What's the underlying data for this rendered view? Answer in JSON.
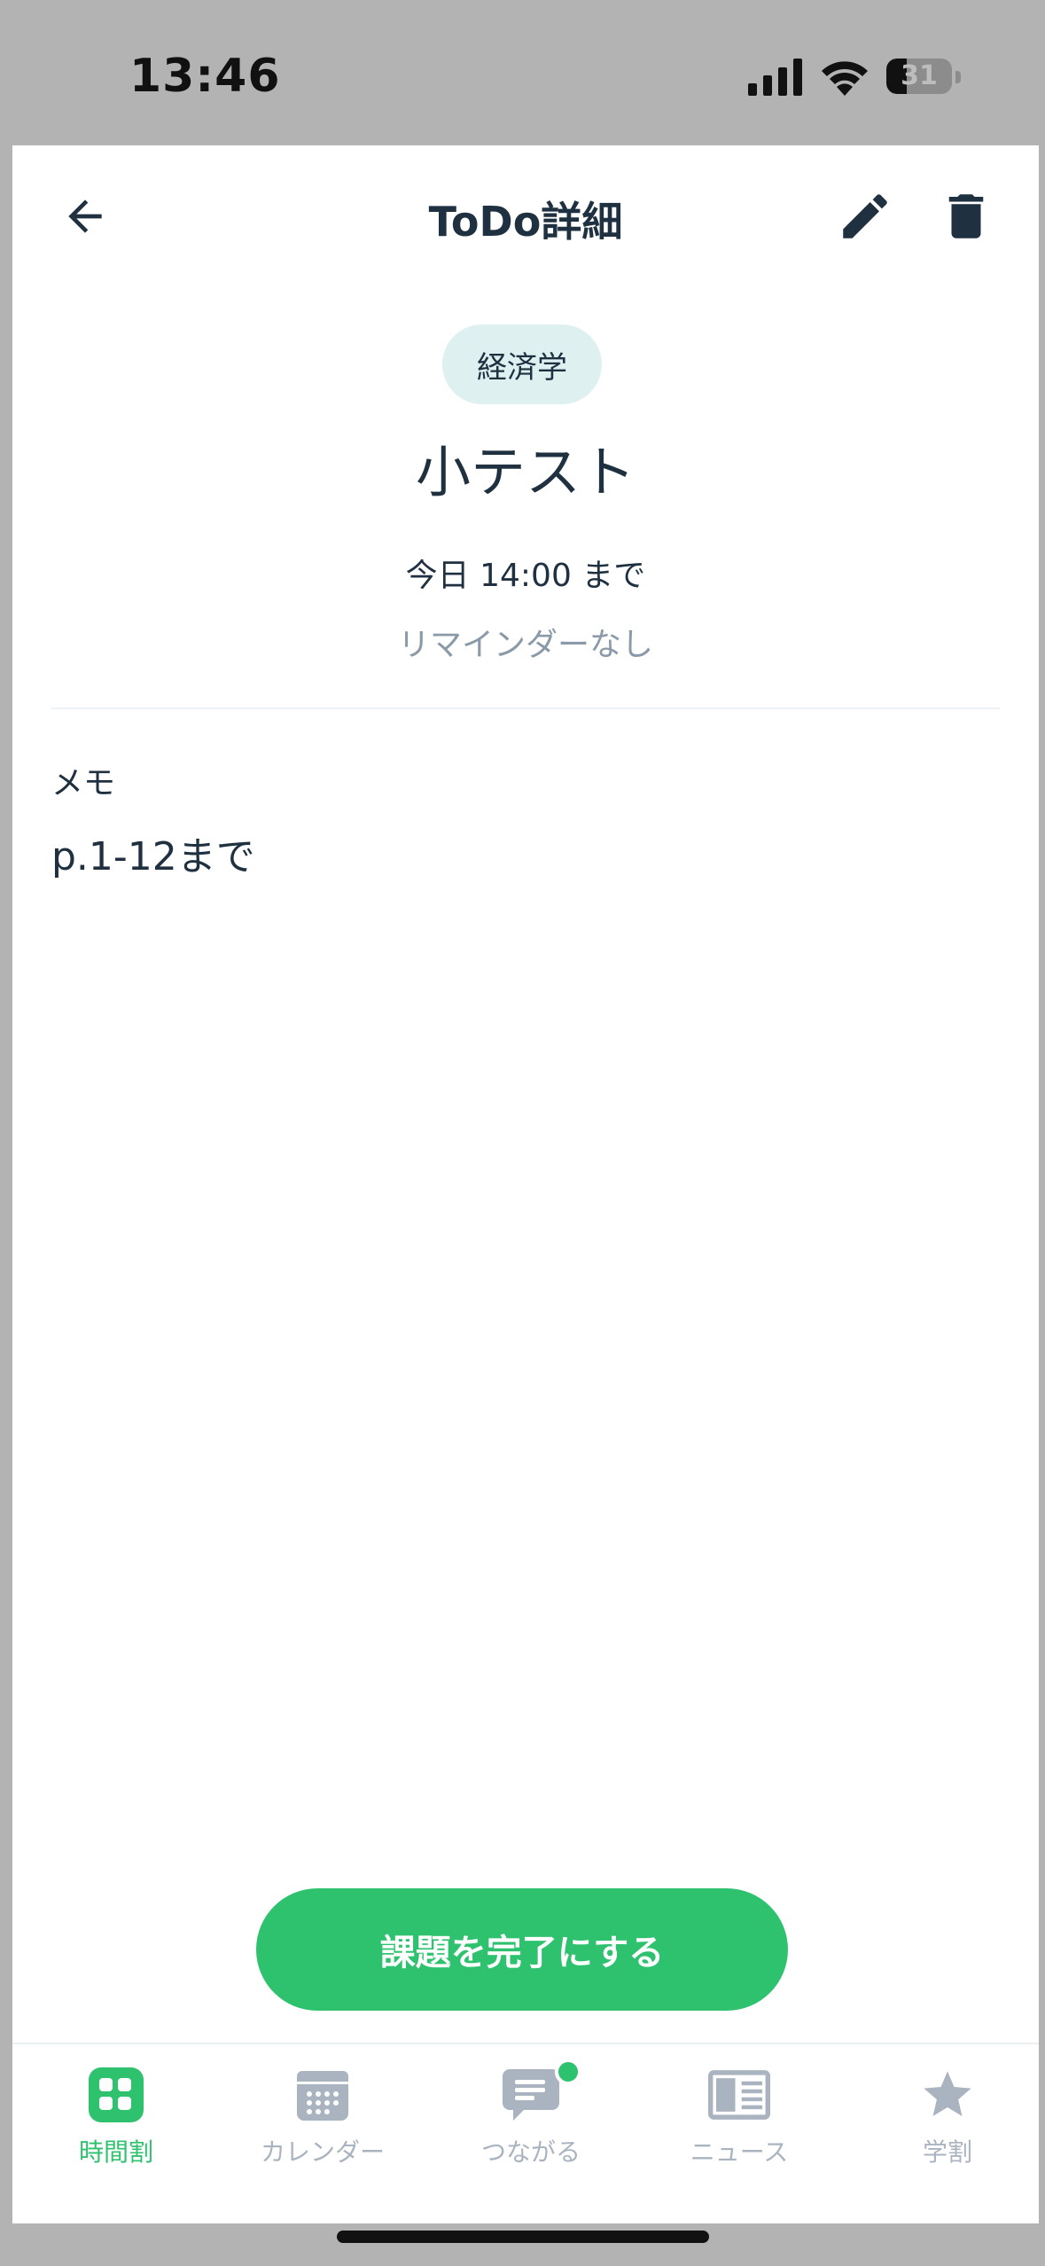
{
  "status_bar": {
    "time": "13:46",
    "battery_level": "31"
  },
  "header": {
    "title": "ToDo詳細",
    "back_icon": "arrow-left-icon",
    "edit_icon": "pencil-icon",
    "delete_icon": "trash-icon"
  },
  "task": {
    "subject": "経済学",
    "title": "小テスト",
    "deadline": "今日 14:00 まで",
    "reminder": "リマインダーなし"
  },
  "memo": {
    "label": "メモ",
    "body": "p.1-12まで"
  },
  "actions": {
    "complete_label": "課題を完了にする"
  },
  "tabbar": {
    "items": [
      {
        "label": "時間割",
        "icon": "timetable-icon",
        "active": true
      },
      {
        "label": "カレンダー",
        "icon": "calendar-icon",
        "active": false
      },
      {
        "label": "つながる",
        "icon": "chat-icon",
        "active": false,
        "badge": true
      },
      {
        "label": "ニュース",
        "icon": "news-icon",
        "active": false
      },
      {
        "label": "学割",
        "icon": "star-icon",
        "active": false
      }
    ]
  },
  "colors": {
    "accent": "#2ec26f",
    "text": "#1f3140",
    "muted": "#8b9aa8",
    "tag_bg": "#dff0f0",
    "tab_inactive": "#aab4c0"
  }
}
